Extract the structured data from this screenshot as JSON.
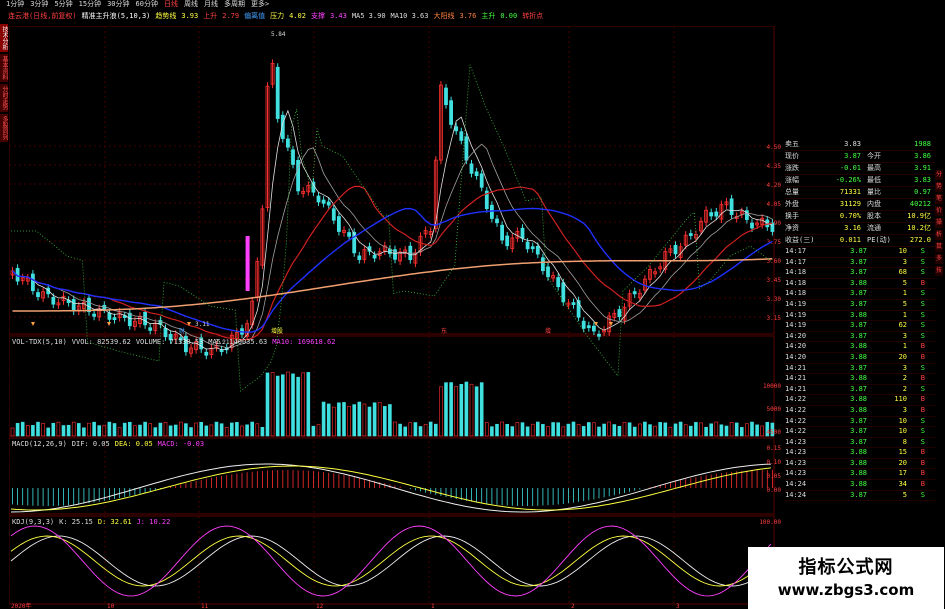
{
  "toolbar": [
    "1分钟",
    "3分钟",
    "5分钟",
    "15分钟",
    "30分钟",
    "60分钟",
    "日线",
    "周线",
    "月线",
    "多周期",
    "更多>"
  ],
  "info": {
    "stock": "连云港(日线,前复权)",
    "indicator": "精准主升浪(5,10,3)",
    "trend_label": "趋势线",
    "trend_val": "3.93",
    "up_label": "上升",
    "up_val": "2.79",
    "dev_label": "偏离值",
    "dev_val": "",
    "resist_label": "压力",
    "resist_val": "4.02",
    "support_label": "支撑",
    "support_val": "3.43",
    "ma5": "MA5 3.90",
    "ma10": "MA10 3.63",
    "big_label": "大阳线",
    "big_val": "3.76",
    "main_label": "主升",
    "main_val": "0.00",
    "tail": "转折点"
  },
  "sidetabs": [
    "技术分析",
    "基本资料",
    "分时走势",
    "多股同列"
  ],
  "price_axis": [
    "4.50",
    "4.35",
    "4.20",
    "4.05",
    "3.90",
    "3.75",
    "3.60",
    "3.45",
    "3.30",
    "3.15"
  ],
  "peak_label": "5.84",
  "low_label_1": "3.11",
  "low_label_2": "3.21",
  "event_marks": [
    "财",
    "增股",
    "东",
    "增"
  ],
  "vol": {
    "title": "VOL-TDX(5,10)",
    "vvol": "VVOL: 82539.62",
    "volume": "VOLUME: 71330.53",
    "ma5": "MA5: 140035.63",
    "ma10": "MA10: 169618.62"
  },
  "vol_axis": [
    "10000",
    "5000",
    "4500"
  ],
  "macd": {
    "title": "MACD(12,26,9)",
    "dif": "DIF: 0.05",
    "dea": "DEA: 0.05",
    "macd": "MACD: -0.03"
  },
  "macd_axis": [
    "0.15",
    "0.10",
    "0.05",
    "0.00"
  ],
  "kdj": {
    "title": "KDJ(9,3,3)",
    "k": "K: 25.15",
    "d": "D: 32.61",
    "j": "J: 10.22"
  },
  "kdj_axis": [
    "100.00",
    "50.00"
  ],
  "date_axis": [
    "2020年",
    "10",
    "11",
    "12",
    "1",
    "2",
    "3"
  ],
  "quote": {
    "top": [
      {
        "label": "卖五",
        "v1": "3.83",
        "v2": "1988"
      },
      {
        "label": "现价",
        "v1": "3.87",
        "k2": "今开",
        "v2": "3.86"
      },
      {
        "label": "涨跌",
        "v1": "-0.01",
        "k2": "最高",
        "v2": "3.91"
      },
      {
        "label": "涨幅",
        "v1": "-0.26%",
        "k2": "最低",
        "v2": "3.83"
      },
      {
        "label": "总量",
        "v1": "71331",
        "k2": "量比",
        "v2": "0.97"
      },
      {
        "label": "外盘",
        "v1": "31129",
        "k2": "内盘",
        "v2": "40212"
      },
      {
        "label": "换手",
        "v1": "0.70%",
        "k2": "股本",
        "v2": "10.9亿"
      },
      {
        "label": "净资",
        "v1": "3.16",
        "k2": "流通",
        "v2": "10.2亿"
      },
      {
        "label": "收益(三)",
        "v1": "0.011",
        "k2": "PE(动)",
        "v2": "272.0"
      }
    ],
    "ticks": [
      {
        "t": "14:17",
        "p": "3.87",
        "v": "10",
        "s": "S"
      },
      {
        "t": "14:17",
        "p": "3.87",
        "v": "3",
        "s": "S"
      },
      {
        "t": "14:18",
        "p": "3.87",
        "v": "68",
        "s": "S"
      },
      {
        "t": "14:18",
        "p": "3.88",
        "v": "5",
        "s": "B"
      },
      {
        "t": "14:18",
        "p": "3.87",
        "v": "1",
        "s": "S"
      },
      {
        "t": "14:19",
        "p": "3.87",
        "v": "5",
        "s": "S"
      },
      {
        "t": "14:19",
        "p": "3.88",
        "v": "1",
        "s": "S"
      },
      {
        "t": "14:19",
        "p": "3.87",
        "v": "62",
        "s": "S"
      },
      {
        "t": "14:20",
        "p": "3.87",
        "v": "3",
        "s": "S"
      },
      {
        "t": "14:20",
        "p": "3.88",
        "v": "1",
        "s": "B"
      },
      {
        "t": "14:20",
        "p": "3.88",
        "v": "20",
        "s": "B"
      },
      {
        "t": "14:21",
        "p": "3.87",
        "v": "3",
        "s": "S"
      },
      {
        "t": "14:21",
        "p": "3.88",
        "v": "2",
        "s": "B"
      },
      {
        "t": "14:21",
        "p": "3.87",
        "v": "2",
        "s": "S"
      },
      {
        "t": "14:22",
        "p": "3.88",
        "v": "110",
        "s": "B"
      },
      {
        "t": "14:22",
        "p": "3.88",
        "v": "3",
        "s": "B"
      },
      {
        "t": "14:22",
        "p": "3.87",
        "v": "10",
        "s": "S"
      },
      {
        "t": "14:22",
        "p": "3.87",
        "v": "10",
        "s": "S"
      },
      {
        "t": "14:23",
        "p": "3.87",
        "v": "8",
        "s": "S"
      },
      {
        "t": "14:23",
        "p": "3.88",
        "v": "15",
        "s": "B"
      },
      {
        "t": "14:23",
        "p": "3.88",
        "v": "20",
        "s": "B"
      },
      {
        "t": "14:23",
        "p": "3.88",
        "v": "17",
        "s": "B"
      },
      {
        "t": "14:24",
        "p": "3.88",
        "v": "34",
        "s": "B"
      },
      {
        "t": "14:24",
        "p": "3.87",
        "v": "5",
        "s": "S"
      }
    ]
  },
  "rtools": [
    "分",
    "势",
    "笔",
    "价",
    "操",
    "析",
    "鼠",
    "多",
    "技"
  ],
  "watermark": {
    "cn": "指标公式网",
    "url": "www.zbgs3.com"
  },
  "colors": {
    "up": "#ff3030",
    "down": "#40e0e0",
    "ma_red": "#d02020",
    "ma_blue": "#2030ff",
    "ma_orange": "#f0a070",
    "ma_white": "#e0e0e0",
    "grid": "#5a0000"
  }
}
